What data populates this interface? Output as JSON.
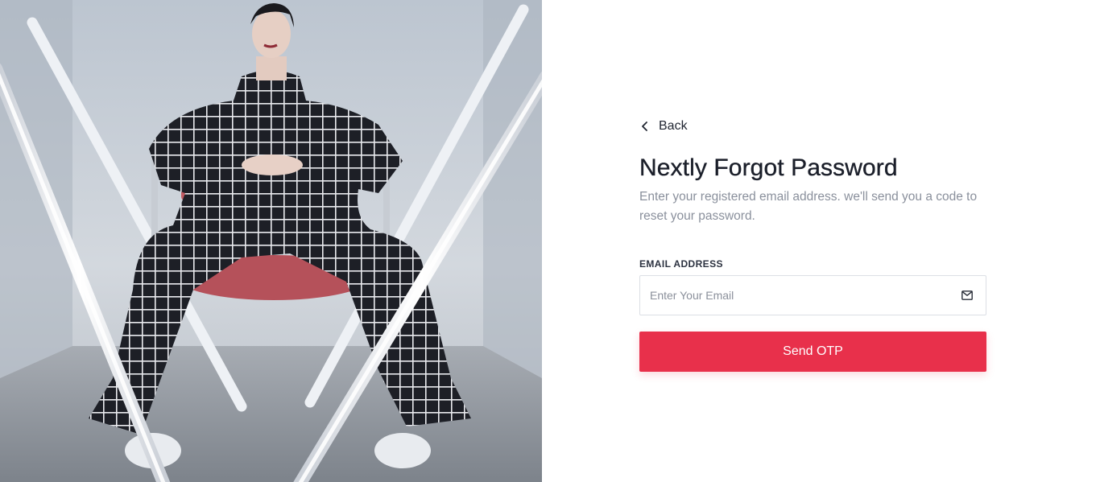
{
  "hero_image": {
    "alt": "Fashion model in checked suit sitting between fluorescent light tubes"
  },
  "form": {
    "back_label": "Back",
    "title": "Nextly Forgot Password",
    "subtitle": "Enter your registered email address. we'll send you a code to reset your password.",
    "email_label": "EMAIL ADDRESS",
    "email_placeholder": "Enter Your Email",
    "email_value": "",
    "submit_label": "Send OTP"
  },
  "icons": {
    "back": "chevron-left-icon",
    "email": "mail-icon"
  },
  "colors": {
    "accent": "#e8304b",
    "title": "#1b1f2a",
    "muted": "#8a909c",
    "border": "#dcdfe5"
  }
}
